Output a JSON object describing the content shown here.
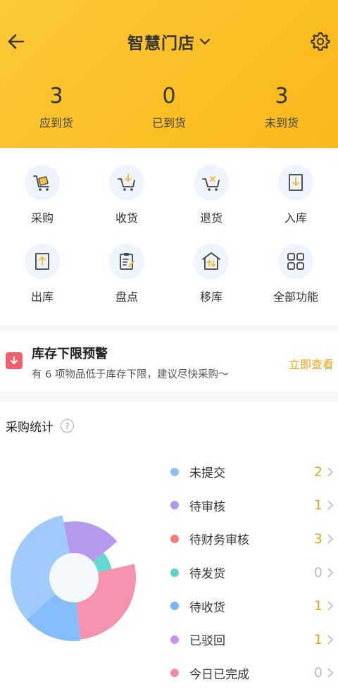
{
  "header": {
    "title": "智慧门店",
    "stats": [
      {
        "num": "3",
        "label": "应到货"
      },
      {
        "num": "0",
        "label": "已到货"
      },
      {
        "num": "3",
        "label": "未到货"
      }
    ]
  },
  "functions": [
    {
      "label": "采购",
      "icon": "purchase-cart-icon"
    },
    {
      "label": "收货",
      "icon": "receive-cart-icon"
    },
    {
      "label": "退货",
      "icon": "return-cart-icon"
    },
    {
      "label": "入库",
      "icon": "stock-in-icon"
    },
    {
      "label": "出库",
      "icon": "stock-out-icon"
    },
    {
      "label": "盘点",
      "icon": "inventory-clipboard-icon"
    },
    {
      "label": "移库",
      "icon": "warehouse-transfer-icon"
    },
    {
      "label": "全部功能",
      "icon": "all-functions-grid-icon"
    }
  ],
  "alert": {
    "title": "库存下限预警",
    "desc": "有 6 项物品低于库存下限，建议尽快采购～",
    "link": "立即查看"
  },
  "purchase_stats": {
    "title": "采购统计",
    "items": [
      {
        "label": "未提交",
        "count": "2",
        "color": "#8ec0f5"
      },
      {
        "label": "待审核",
        "count": "1",
        "color": "#b394ee"
      },
      {
        "label": "待财务审核",
        "count": "3",
        "color": "#f37b7b"
      },
      {
        "label": "待发货",
        "count": "0",
        "color": "#5ed3cc"
      },
      {
        "label": "待收货",
        "count": "1",
        "color": "#78b4f7"
      },
      {
        "label": "已驳回",
        "count": "1",
        "color": "#c792f0"
      },
      {
        "label": "今日已完成",
        "count": "0",
        "color": "#f48bad"
      }
    ]
  },
  "chart_data": {
    "type": "pie",
    "slices": [
      {
        "color": "#b499ee",
        "value": 1
      },
      {
        "color": "#9fcbfb",
        "value": 2
      },
      {
        "color": "#84bdfa",
        "value": 0.9
      },
      {
        "color": "#f592ae",
        "value": 1.6
      },
      {
        "color": "#63d7d0",
        "value": 0.45
      }
    ]
  }
}
